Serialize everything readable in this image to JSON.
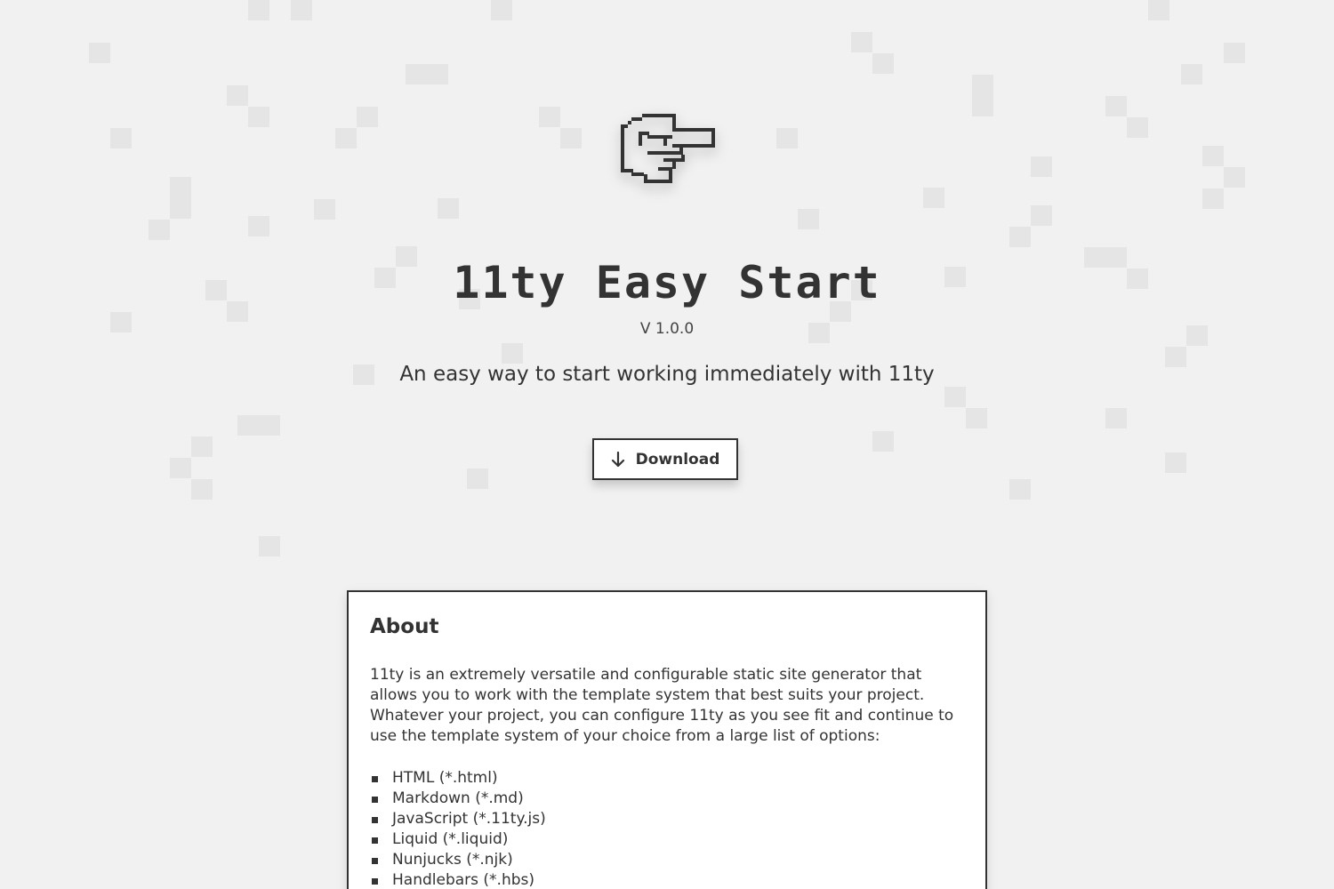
{
  "hero": {
    "logo_icon": "pointing-hand-icon",
    "title": "11ty Easy Start",
    "version": "V 1.0.0",
    "tagline": "An easy way to start working immediately with 11ty"
  },
  "download": {
    "icon": "arrow-down-icon",
    "label": "Download"
  },
  "about": {
    "heading": "About",
    "paragraph": "11ty is an extremely versatile and configurable static site generator that allows you to work with the template system that best suits your project. Whatever your project, you can configure 11ty as you see fit and continue to use the template system of your choice from a large list of options:",
    "formats": [
      "HTML (*.html)",
      "Markdown (*.md)",
      "JavaScript (*.11ty.js)",
      "Liquid (*.liquid)",
      "Nunjucks (*.njk)",
      "Handlebars (*.hbs)"
    ]
  },
  "colors": {
    "background": "#f1f1f1",
    "pixel": "#e5e5e5",
    "ink": "#333333",
    "card": "#ffffff"
  }
}
